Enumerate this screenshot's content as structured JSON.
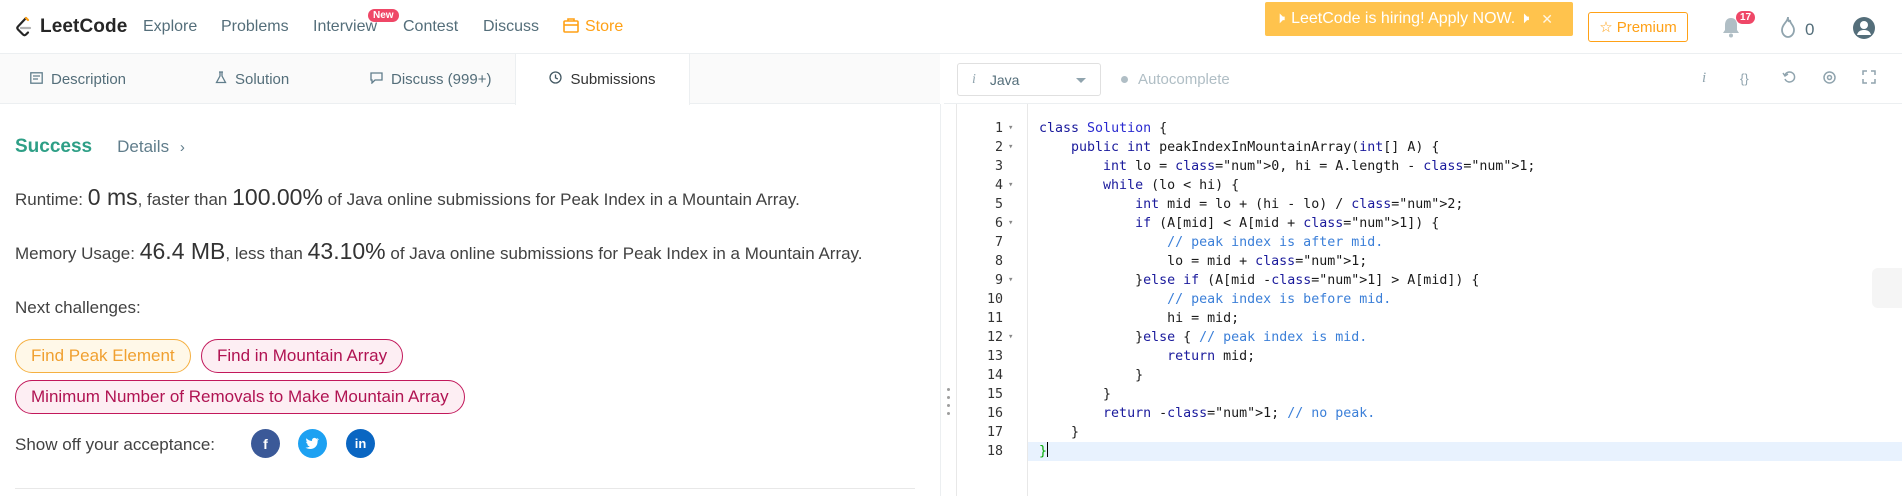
{
  "nav": {
    "brand": "LeetCode",
    "links": [
      "Explore",
      "Problems",
      "Interview",
      "Contest",
      "Discuss",
      "Store"
    ],
    "new_badge": "New",
    "hiring": "LeetCode is hiring! Apply NOW.",
    "premium": "Premium",
    "notif_count": "17",
    "streak": "0"
  },
  "tabs": [
    "Description",
    "Solution",
    "Discuss (999+)",
    "Submissions"
  ],
  "editor_toolbar": {
    "language": "Java",
    "autocomplete": "Autocomplete"
  },
  "submission": {
    "status": "Success",
    "details": "Details",
    "runtime": {
      "label": "Runtime:",
      "value": "0 ms",
      "cmp": ", faster than",
      "pct": "100.00%",
      "suffix": "of Java online submissions for Peak Index in a Mountain Array."
    },
    "memory": {
      "label": "Memory Usage:",
      "value": "46.4 MB",
      "cmp": ", less than",
      "pct": "43.10%",
      "suffix": "of Java online submissions for Peak Index in a Mountain Array."
    },
    "next_label": "Next challenges:",
    "challenges": [
      "Find Peak Element",
      "Find in Mountain Array",
      "Minimum Number of Removals to Make Mountain Array"
    ],
    "share_label": "Show off your acceptance:"
  },
  "code": {
    "lines": [
      "class Solution {",
      "    public int peakIndexInMountainArray(int[] A) {",
      "        int lo = 0, hi = A.length - 1;",
      "        while (lo < hi) {",
      "            int mid = lo + (hi - lo) / 2;",
      "            if (A[mid] < A[mid + 1]) {",
      "                // peak index is after mid.",
      "                lo = mid + 1;",
      "            }else if (A[mid -1] > A[mid]) {",
      "                // peak index is before mid.",
      "                hi = mid;",
      "            }else { // peak index is mid.",
      "                return mid;",
      "            }",
      "        }",
      "        return -1; // no peak.",
      "    }",
      "}"
    ],
    "line_numbers": [
      "1",
      "2",
      "3",
      "4",
      "5",
      "6",
      "7",
      "8",
      "9",
      "10",
      "11",
      "12",
      "13",
      "14",
      "15",
      "16",
      "17",
      "18"
    ],
    "fold_lines": [
      1,
      2,
      4,
      6,
      9,
      12
    ]
  },
  "colors": {
    "accent": "#ffa116",
    "success": "#2e9f86",
    "facebook": "#3b5998",
    "twitter": "#1da1f2",
    "linkedin": "#0a66c2"
  }
}
